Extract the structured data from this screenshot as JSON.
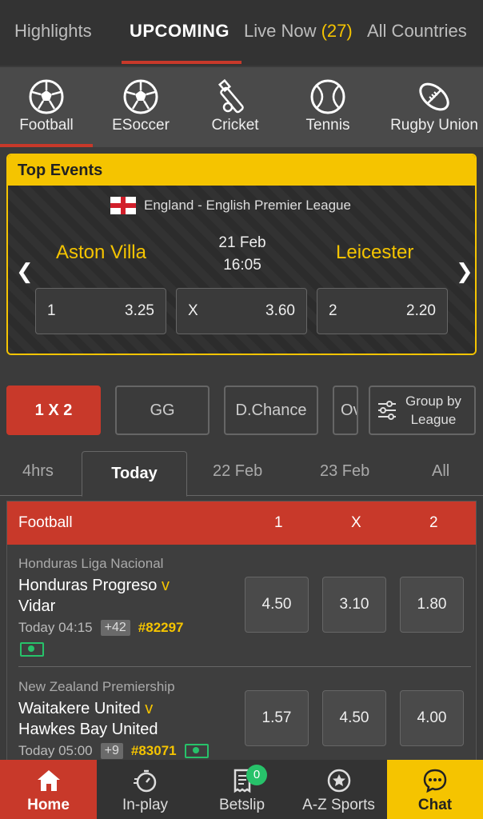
{
  "topnav": {
    "highlights": "Highlights",
    "upcoming": "UPCOMING",
    "live_now": "Live Now",
    "live_count": "(27)",
    "all_countries": "All Countries"
  },
  "sports": [
    {
      "label": "Football",
      "icon": "football-icon"
    },
    {
      "label": "ESoccer",
      "icon": "esoccer-icon"
    },
    {
      "label": "Cricket",
      "icon": "cricket-icon"
    },
    {
      "label": "Tennis",
      "icon": "tennis-icon"
    },
    {
      "label": "Rugby Union",
      "icon": "rugby-icon"
    }
  ],
  "top_events": {
    "title": "Top Events",
    "league": "England - English Premier League",
    "home": "Aston Villa",
    "away": "Leicester",
    "date": "21 Feb",
    "time": "16:05",
    "odds": [
      {
        "key": "1",
        "value": "3.25"
      },
      {
        "key": "X",
        "value": "3.60"
      },
      {
        "key": "2",
        "value": "2.20"
      }
    ]
  },
  "markets": {
    "m1": "1 X 2",
    "m2": "GG",
    "m3": "D.Chance",
    "m4": "Ov",
    "group_by_line1": "Group by",
    "group_by_line2": "League"
  },
  "date_tabs": [
    "4hrs",
    "Today",
    "22 Feb",
    "23 Feb",
    "All"
  ],
  "list": {
    "sport": "Football",
    "col1": "1",
    "colx": "X",
    "col2": "2",
    "matches": [
      {
        "league": "Honduras Liga Nacional",
        "home": "Honduras Progreso",
        "vs": "v",
        "away": "Vidar",
        "time": "Today 04:15",
        "more": "+42",
        "code": "#82297",
        "odds": [
          "4.50",
          "3.10",
          "1.80"
        ]
      },
      {
        "league": "New Zealand Premiership",
        "home": "Waitakere United",
        "vs": "v",
        "away": "Hawkes Bay United",
        "time": "Today 05:00",
        "more": "+9",
        "code": "#83071",
        "odds": [
          "1.57",
          "4.50",
          "4.00"
        ]
      }
    ]
  },
  "bottomnav": {
    "home": "Home",
    "inplay": "In-play",
    "betslip": "Betslip",
    "betslip_count": "0",
    "az": "A-Z Sports",
    "chat": "Chat"
  },
  "colors": {
    "accent_red": "#c8392a",
    "accent_yellow": "#f5c400",
    "cashout_green": "#27c26a"
  }
}
